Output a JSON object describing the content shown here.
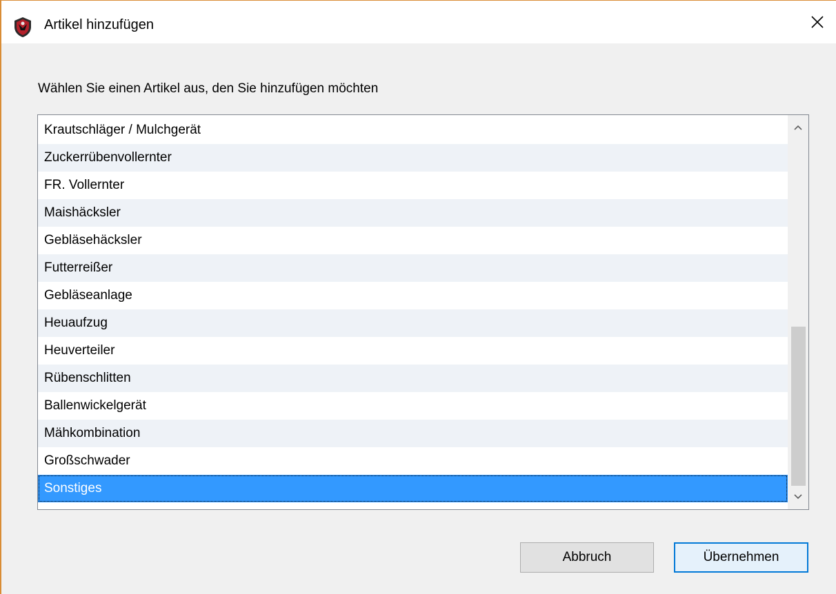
{
  "window": {
    "title": "Artikel hinzufügen",
    "close_icon": "close-icon",
    "app_icon": "app-shield-icon"
  },
  "instruction": "Wählen Sie einen Artikel aus, den Sie hinzufügen möchten",
  "list": {
    "items": [
      "Krautschläger / Mulchgerät",
      "Zuckerrübenvollernter",
      "FR. Vollernter",
      "Maishäcksler",
      "Gebläsehäcksler",
      "Futterreißer",
      "Gebläseanlage",
      "Heuaufzug",
      "Heuverteiler",
      "Rübenschlitten",
      "Ballenwickelgerät",
      "Mähkombination",
      "Großschwader",
      "Sonstiges"
    ],
    "selected_index": 13
  },
  "buttons": {
    "cancel_label": "Abbruch",
    "apply_label": "Übernehmen"
  },
  "colors": {
    "selection": "#3399ff",
    "alt_row": "#eef2f7",
    "window_border": "#d98c35",
    "default_button_border": "#0078d7"
  }
}
